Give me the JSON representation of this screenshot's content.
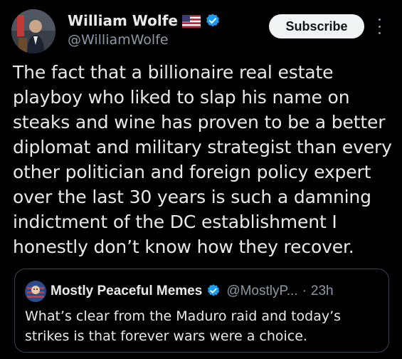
{
  "author": {
    "name": "William Wolfe",
    "handle": "@WilliamWolfe",
    "flag_icon": "us-flag-icon",
    "verified_icon": "verified-badge-icon",
    "verified_color": "#1d9bf0"
  },
  "header": {
    "subscribe_label": "Subscribe",
    "more_icon": "more-vertical-icon"
  },
  "post": {
    "lines": [
      "The fact that a billionaire real estate",
      "playboy who liked to slap his name on",
      "steaks and wine has proven to be a better",
      "diplomat and military strategist than every",
      "other politician and foreign policy expert",
      "over the last 30 years is such a damning",
      "indictment of the DC establishment I",
      "honestly don’t know how they recover."
    ]
  },
  "quote": {
    "name": "Mostly Peaceful Memes",
    "handle": "@MostlyP...",
    "separator": "·",
    "time": "23h",
    "lines": [
      "What’s clear from the Maduro raid and today’s",
      "strikes is that forever wars were a choice."
    ]
  }
}
